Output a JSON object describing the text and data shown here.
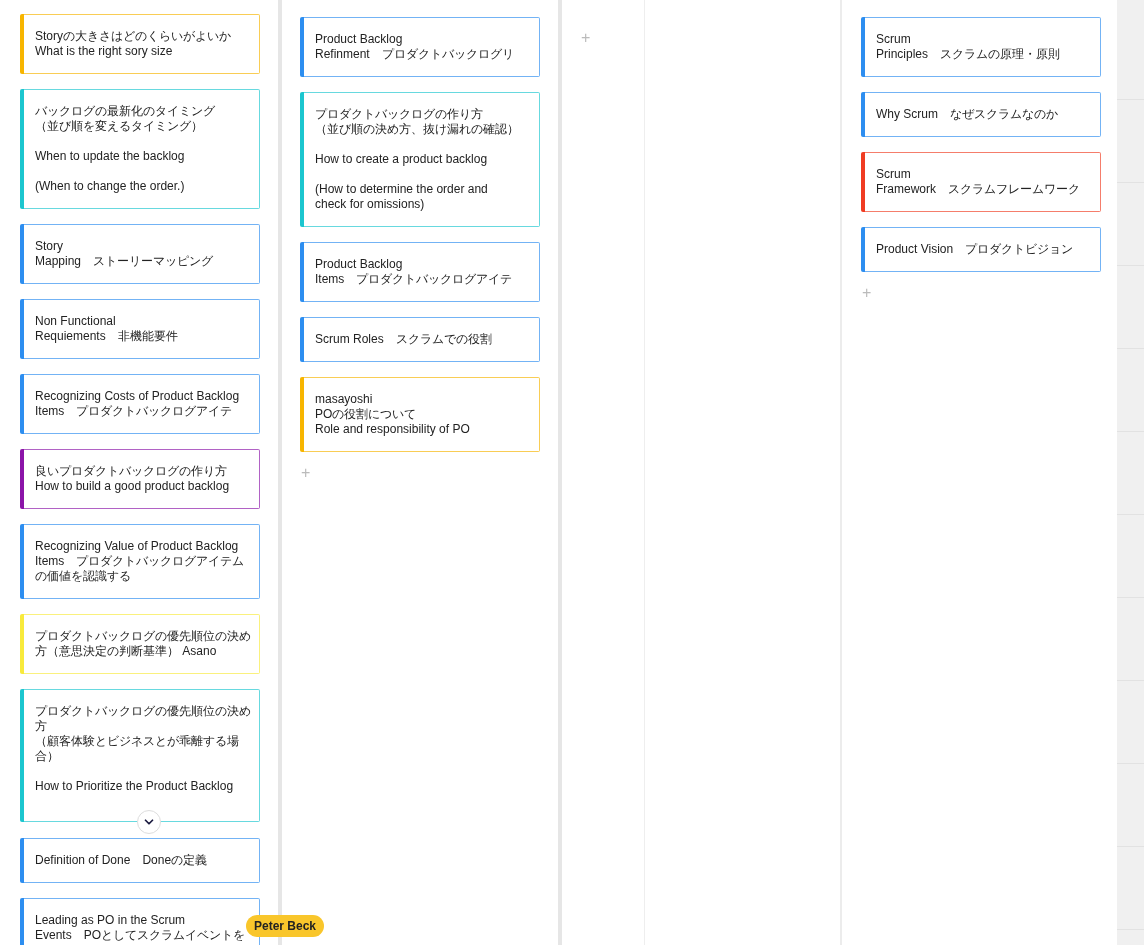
{
  "columns": [
    {
      "cards": [
        {
          "paragraphs": [
            [
              "Storyの大きさはどのくらいがよいか",
              "What is the right sory size"
            ]
          ],
          "color": "#f7b500",
          "collapsed": false
        },
        {
          "paragraphs": [
            [
              "バックログの最新化のタイミング",
              "（並び順を変えるタイミング）"
            ],
            [
              "When to update the backlog"
            ],
            [
              "(When to change the order.)"
            ]
          ],
          "color": "#1cc6cf",
          "collapsed": false
        },
        {
          "paragraphs": [
            [
              "Story",
              "Mapping　ストーリーマッピング"
            ]
          ],
          "color": "#2d8ef0",
          "collapsed": false
        },
        {
          "paragraphs": [
            [
              "Non Functional",
              "Requiements　非機能要件"
            ]
          ],
          "color": "#2d8ef0",
          "collapsed": false
        },
        {
          "paragraphs": [
            [
              "Recognizing Costs of Product Backlog",
              "Items　プロダクトバックログアイテ"
            ]
          ],
          "color": "#2d8ef0",
          "collapsed": false
        },
        {
          "paragraphs": [
            [
              "良いプロダクトバックログの作り方",
              "How to build a good product backlog"
            ]
          ],
          "color": "#8b14a8",
          "collapsed": false
        },
        {
          "paragraphs": [
            [
              "Recognizing Value of Product Backlog",
              "Items　プロダクトバックログアイテムの価値を認識する"
            ]
          ],
          "color": "#2d8ef0",
          "collapsed": false
        },
        {
          "paragraphs": [
            [
              "プロダクトバックログの優先順位の決め方（意思決定の判断基準） Asano"
            ]
          ],
          "color": "#f8ea3c",
          "collapsed": false
        },
        {
          "paragraphs": [
            [
              "プロダクトバックログの優先順位の決め方",
              "（顧客体験とビジネスとが乖離する場合）"
            ],
            [
              "How to Prioritize the Product Backlog"
            ]
          ],
          "color": "#1cc6cf",
          "collapsed": true
        },
        {
          "paragraphs": [
            [
              "Definition of Done　Doneの定義"
            ]
          ],
          "color": "#2d8ef0",
          "collapsed": false
        },
        {
          "paragraphs": [
            [
              "Leading as PO in the Scrum",
              "Events　POとしてスクラムイベントを"
            ]
          ],
          "color": "#2d8ef0",
          "collapsed": false
        }
      ]
    },
    {
      "cards": [
        {
          "paragraphs": [
            [
              "Product Backlog",
              "Refinment　プロダクトバックログリ"
            ]
          ],
          "color": "#2d8ef0",
          "collapsed": false
        },
        {
          "paragraphs": [
            [
              "プロダクトバックログの作り方",
              "（並び順の決め方、抜け漏れの確認）"
            ],
            [
              "How to create a product backlog"
            ],
            [
              "(How to determine the order and",
              "check for omissions)"
            ]
          ],
          "color": "#1cc6cf",
          "collapsed": false
        },
        {
          "paragraphs": [
            [
              "Product Backlog",
              "Items　プロダクトバックログアイテ"
            ]
          ],
          "color": "#2d8ef0",
          "collapsed": false
        },
        {
          "paragraphs": [
            [
              "Scrum Roles　スクラムでの役割"
            ]
          ],
          "color": "#2d8ef0",
          "collapsed": false
        },
        {
          "paragraphs": [
            [
              "masayoshi",
              "POの役割について",
              "Role and responsibility of PO"
            ]
          ],
          "color": "#f7b500",
          "collapsed": false
        }
      ],
      "add": "+"
    },
    {
      "add": "+"
    },
    {
      "cards": [
        {
          "paragraphs": [
            [
              "Scrum",
              "Principles　スクラムの原理・原則"
            ]
          ],
          "color": "#2d8ef0",
          "collapsed": false
        },
        {
          "paragraphs": [
            [
              "Why Scrum　なぜスクラムなのか"
            ]
          ],
          "color": "#2d8ef0",
          "collapsed": false
        },
        {
          "paragraphs": [
            [
              "Scrum",
              "Framework　スクラムフレームワーク"
            ]
          ],
          "color": "#f03c22",
          "collapsed": false
        },
        {
          "paragraphs": [
            [
              "Product Vision　プロダクトビジョン"
            ]
          ],
          "color": "#2d8ef0",
          "collapsed": false
        }
      ],
      "add": "+"
    }
  ],
  "cursor": {
    "name": "Peter Beck",
    "color": "#f9c62b"
  }
}
